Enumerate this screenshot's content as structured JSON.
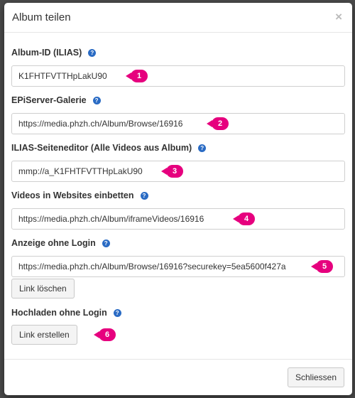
{
  "dialog": {
    "title": "Album teilen",
    "close_glyph": "×",
    "fields": [
      {
        "label": "Album-ID (ILIAS)",
        "value": "K1FHTFVTTHpLakU90",
        "badge": "1"
      },
      {
        "label": "EPiServer-Galerie",
        "value": "https://media.phzh.ch/Album/Browse/16916",
        "badge": "2"
      },
      {
        "label": "ILIAS-Seiteneditor (Alle Videos aus Album)",
        "value": "mmp://a_K1FHTFVTTHpLakU90",
        "badge": "3"
      },
      {
        "label": "Videos in Websites einbetten",
        "value": "https://media.phzh.ch/Album/iframeVideos/16916",
        "badge": "4"
      },
      {
        "label": "Anzeige ohne Login",
        "value": "https://media.phzh.ch/Album/Browse/16916?securekey=5ea5600f427a",
        "badge": "5",
        "button": "Link löschen"
      },
      {
        "label": "Hochladen ohne Login",
        "badge": "6",
        "button": "Link erstellen"
      }
    ],
    "help_glyph": "?",
    "footer_button": "Schliessen"
  },
  "colors": {
    "badge": "#e6007e",
    "help": "#2a6bc4"
  },
  "icons": {
    "help": "question-circle-icon",
    "close": "close-icon"
  }
}
